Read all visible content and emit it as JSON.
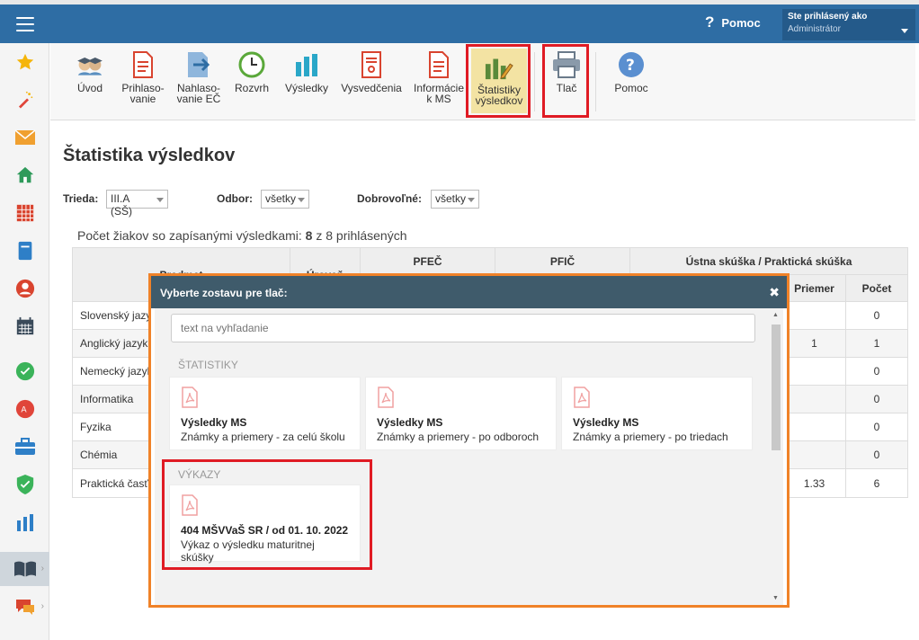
{
  "header": {
    "help_label": "Pomoc",
    "help_glyph": "?",
    "user_line1": "Ste prihlásený ako",
    "user_line2": "Administrátor"
  },
  "sidebar": {
    "items": [
      {
        "icon": "star-icon",
        "color": "#f5b50a"
      },
      {
        "icon": "magic-wand-icon",
        "color": "#e0453a"
      },
      {
        "icon": "envelope-icon",
        "color": "#f0a030"
      },
      {
        "icon": "home-icon",
        "color": "#2e9a5a"
      },
      {
        "icon": "grid-calendar-icon",
        "color": "#d9442f"
      },
      {
        "icon": "notebook-icon",
        "color": "#2e7fc7"
      },
      {
        "icon": "user-icon",
        "color": "#d9442f"
      },
      {
        "icon": "calendar-icon",
        "color": "#3a4a5a"
      },
      {
        "icon": "check-circle-icon",
        "color": "#3bb35a"
      },
      {
        "icon": "badge-icon",
        "color": "#e0453a"
      },
      {
        "icon": "briefcase-icon",
        "color": "#2e7fc7"
      },
      {
        "icon": "shield-icon",
        "color": "#3bb35a"
      },
      {
        "icon": "bar-chart-icon",
        "color": "#2e7fc7"
      },
      {
        "icon": "open-book-icon",
        "color": "#3a4a5a"
      },
      {
        "icon": "chat-icon",
        "color": "#d9442f"
      }
    ]
  },
  "toolbar": {
    "items": [
      {
        "label": "Úvod",
        "icon": "people-icon"
      },
      {
        "label": "Prihlaso-\nvanie",
        "icon": "document-icon"
      },
      {
        "label": "Nahlaso-\nvanie EČ",
        "icon": "arrow-export-icon"
      },
      {
        "label": "Rozvrh",
        "icon": "clock-icon"
      },
      {
        "label": "Výsledky",
        "icon": "bar-chart-icon"
      },
      {
        "label": "Vysvedčenia",
        "icon": "certificate-icon"
      },
      {
        "label": "Informácie\nk MS",
        "icon": "document-icon"
      },
      {
        "label": "Štatistiky\nvýsledkov",
        "icon": "chart-pencil-icon"
      },
      {
        "label": "Tlač",
        "icon": "printer-icon"
      },
      {
        "label": "Pomoc",
        "icon": "help-icon"
      }
    ]
  },
  "page": {
    "title": "Štatistika výsledkov",
    "filters": {
      "trieda_label": "Trieda:",
      "trieda_value": "III.A (SŠ)",
      "odbor_label": "Odbor:",
      "odbor_value": "všetky",
      "dobrovolne_label": "Dobrovoľné:",
      "dobrovolne_value": "všetky"
    },
    "count_prefix": "Počet žiakov so zapísanými výsledkami: ",
    "count_value": "8",
    "count_suffix": " z 8 prihlásených"
  },
  "table": {
    "headers": {
      "predmet": "Predmet",
      "uroven": "Úroveň",
      "pfec": "PFEČ",
      "pfic": "PFIČ",
      "ustna": "Ústna skúška / Praktická skúška",
      "priemer": "Priemer",
      "pocet": "Počet"
    },
    "rows": [
      {
        "subject": "Slovenský jazyk",
        "priemer": "",
        "pocet": "0"
      },
      {
        "subject": "Anglický jazyk",
        "priemer": "1",
        "pocet": "1"
      },
      {
        "subject": "Nemecký jazyk",
        "priemer": "",
        "pocet": "0"
      },
      {
        "subject": "Informatika",
        "priemer": "",
        "pocet": "0"
      },
      {
        "subject": "Fyzika",
        "priemer": "",
        "pocet": "0"
      },
      {
        "subject": "Chémia",
        "priemer": "",
        "pocet": "0"
      },
      {
        "subject": "Praktická časť",
        "priemer": "1.33",
        "pocet": "6"
      }
    ]
  },
  "modal": {
    "title": "Vyberte zostavu pre tlač:",
    "close_glyph": "✖",
    "search_placeholder": "text na vyhľadanie",
    "section_statistiky": "ŠTATISTIKY",
    "section_vykazy": "VÝKAZY",
    "cards": [
      {
        "title": "Výsledky MS",
        "subtitle": "Známky a priemery - za celú školu"
      },
      {
        "title": "Výsledky MS",
        "subtitle": "Známky a priemery - po odboroch"
      },
      {
        "title": "Výsledky MS",
        "subtitle": "Známky a priemery - po triedach"
      }
    ],
    "report": {
      "title": "404 MŠVVaŠ SR / od 01. 10. 2022",
      "subtitle": "Výkaz o výsledku maturitnej skúšky"
    }
  }
}
